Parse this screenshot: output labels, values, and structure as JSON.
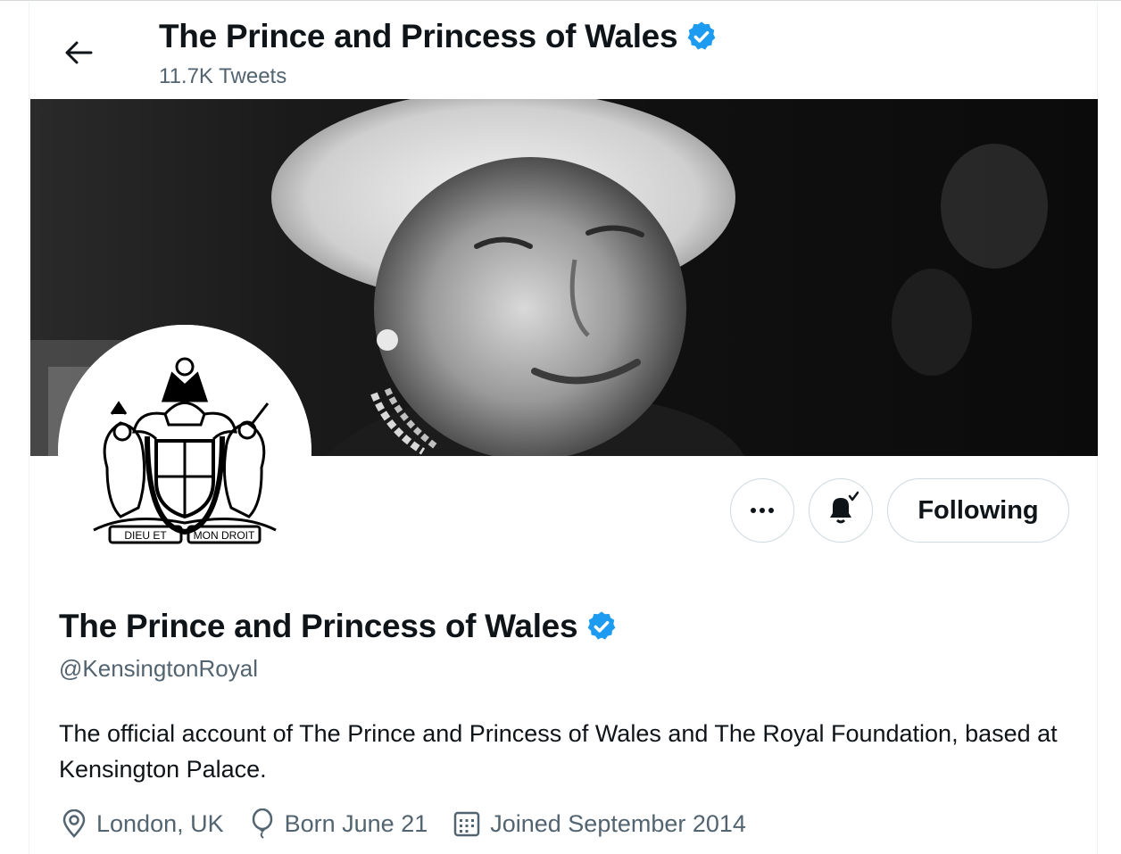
{
  "header": {
    "title": "The Prince and Princess of Wales",
    "tweet_count": "11.7K Tweets"
  },
  "actions": {
    "more_icon": "more-horizontal-icon",
    "notify_icon": "bell-check-icon",
    "following_label": "Following"
  },
  "profile": {
    "name": "The Prince and Princess of Wales",
    "handle": "@KensingtonRoyal",
    "bio": "The official account of The Prince and Princess of Wales and The Royal Foundation, based at Kensington Palace.",
    "location": "London, UK",
    "birthday": "Born June 21",
    "joined": "Joined September 2014",
    "avatar_motto_left": "DIEU ET",
    "avatar_motto_right": "MON DROIT"
  },
  "colors": {
    "verified": "#1d9bf0",
    "text_primary": "#0f1419",
    "text_secondary": "#536471",
    "border": "#cfd9de"
  }
}
